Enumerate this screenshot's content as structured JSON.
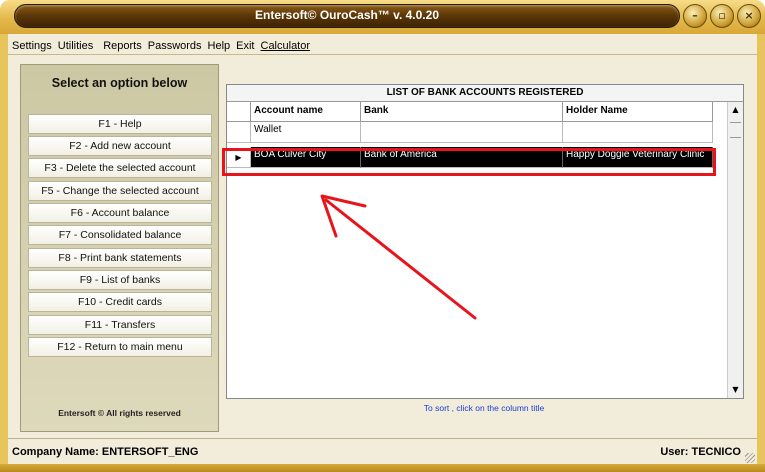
{
  "window": {
    "title": "Entersoft© OuroCash™ v. 4.0.20",
    "controls": [
      "minimize",
      "maximize",
      "close"
    ]
  },
  "menu": {
    "items": [
      "Settings",
      "Utilities",
      "Reports",
      "Passwords",
      "Help",
      "Exit",
      "Calculator"
    ]
  },
  "sidebar": {
    "title": "Select an option below",
    "options": [
      "F1 - Help",
      "F2 - Add new account",
      "F3 - Delete the selected account",
      "F5 - Change the selected account",
      "F6 - Account balance",
      "F7 - Consolidated balance",
      "F8 - Print bank statements",
      "F9 - List of banks",
      "F10 - Credit cards",
      "F11 - Transfers",
      "F12 - Return to main menu"
    ],
    "footer": "Entersoft © All rights reserved"
  },
  "grid": {
    "caption": "LIST OF BANK ACCOUNTS REGISTERED",
    "columns": [
      "Account name",
      "Bank",
      "Holder Name"
    ],
    "rows": [
      {
        "account": "Wallet",
        "bank": "",
        "holder": ""
      },
      {
        "account": "BOA Culver City",
        "bank": "Bank of America",
        "holder": "Happy Doggie Veterinary Clinic"
      }
    ],
    "selected_row": 1,
    "hint": "To sort , click on the column title"
  },
  "status": {
    "company": "Company Name: ENTERSOFT_ENG",
    "user": "User: TECNICO"
  },
  "colors": {
    "accent_frame": "#e8c45c",
    "highlight": "#e8141c",
    "selected_row_bg": "#000000",
    "hint_text": "#1a3dd4"
  }
}
